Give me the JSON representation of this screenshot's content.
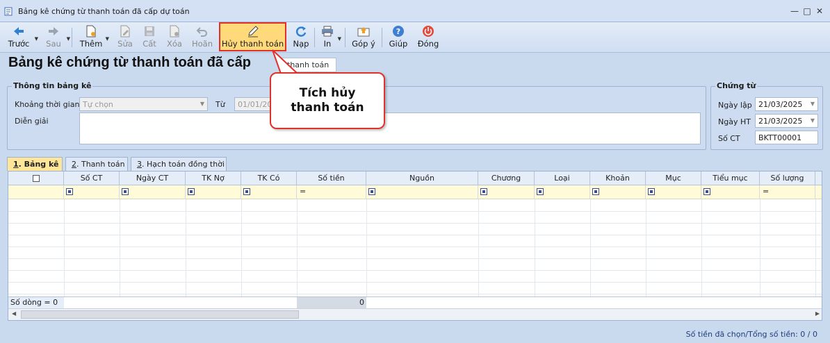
{
  "window": {
    "title": "Bảng kê chứng từ thanh toán đã cấp dự toán"
  },
  "toolbar": {
    "prev": "Trước",
    "next": "Sau",
    "add": "Thêm",
    "edit": "Sửa",
    "save": "Cất",
    "delete": "Xóa",
    "undo": "Hoãn",
    "cancel_payment": "Hủy thanh toán",
    "reload": "Nạp",
    "print": "In",
    "feedback": "Góp ý",
    "help": "Giúp",
    "close": "Đóng"
  },
  "header": {
    "title": "Bảng kê chứng từ thanh toán đã cấp",
    "tab_tag": "thanh toán"
  },
  "info": {
    "group_title": "Thông tin bảng kê",
    "period_label": "Khoảng thời gian",
    "period_value": "Tự chọn",
    "from_label": "Từ",
    "from_value": "01/01/20",
    "desc_label": "Diễn giải",
    "desc_value": ""
  },
  "voucher": {
    "group_title": "Chứng từ",
    "date_label": "Ngày lập",
    "date_value": "21/03/2025",
    "post_label": "Ngày HT",
    "post_value": "21/03/2025",
    "no_label": "Số CT",
    "no_value": "BKTT00001"
  },
  "tabs": [
    {
      "num": "1",
      "label": ". Bảng kê"
    },
    {
      "num": "2",
      "label": ". Thanh toán"
    },
    {
      "num": "3",
      "label": ". Hạch toán đồng thời"
    }
  ],
  "grid": {
    "columns": [
      "Số CT",
      "Ngày CT",
      "TK Nợ",
      "TK Có",
      "Số tiền",
      "Nguồn",
      "Chương",
      "Loại",
      "Khoản",
      "Mục",
      "Tiểu mục",
      "Số lượng"
    ],
    "footer_count": "Số dòng = 0",
    "footer_total": "0"
  },
  "status": {
    "text": "Số tiền đã chọn/Tổng số tiền: 0 / 0"
  },
  "callout": {
    "line1": "Tích hủy",
    "line2": "thanh toán"
  }
}
